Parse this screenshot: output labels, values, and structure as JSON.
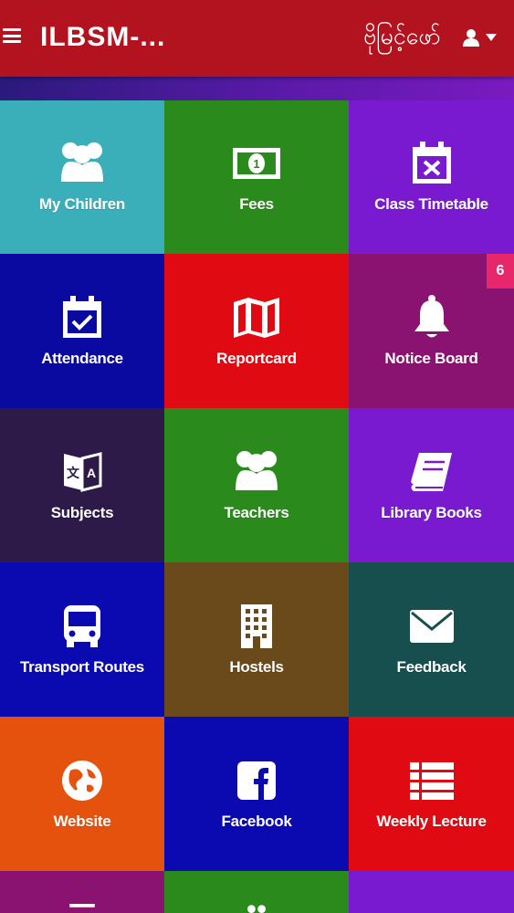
{
  "header": {
    "title": "ILBSM-...",
    "language": "ဗိုမြင့်ဖော်",
    "menu_icon": "hamburger-icon",
    "user_icon": "user-icon",
    "dropdown_icon": "caret-down-icon"
  },
  "tiles": [
    {
      "label": "My Children",
      "icon": "children-icon",
      "color": "#3aaeb9"
    },
    {
      "label": "Fees",
      "icon": "money-icon",
      "color": "#2a8a1c"
    },
    {
      "label": "Class Timetable",
      "icon": "calendar-x-icon",
      "color": "#7a1ad0"
    },
    {
      "label": "Attendance",
      "icon": "calendar-check-icon",
      "color": "#0a0aa0"
    },
    {
      "label": "Reportcard",
      "icon": "map-icon",
      "color": "#e00a12"
    },
    {
      "label": "Notice Board",
      "icon": "bell-icon",
      "color": "#8a1270",
      "badge": "6"
    },
    {
      "label": "Subjects",
      "icon": "translate-icon",
      "color": "#2e1a48"
    },
    {
      "label": "Teachers",
      "icon": "teachers-icon",
      "color": "#2a8a1c"
    },
    {
      "label": "Library Books",
      "icon": "book-icon",
      "color": "#7a1ad0"
    },
    {
      "label": "Transport Routes",
      "icon": "bus-icon",
      "color": "#0a0ab0"
    },
    {
      "label": "Hostels",
      "icon": "building-icon",
      "color": "#6a4a1a"
    },
    {
      "label": "Feedback",
      "icon": "envelope-icon",
      "color": "#174e4e"
    },
    {
      "label": "Website",
      "icon": "globe-icon",
      "color": "#e5520e"
    },
    {
      "label": "Facebook",
      "icon": "facebook-icon",
      "color": "#0a0ab0"
    },
    {
      "label": "Weekly Lecture",
      "icon": "list-icon",
      "color": "#e00a12"
    }
  ]
}
